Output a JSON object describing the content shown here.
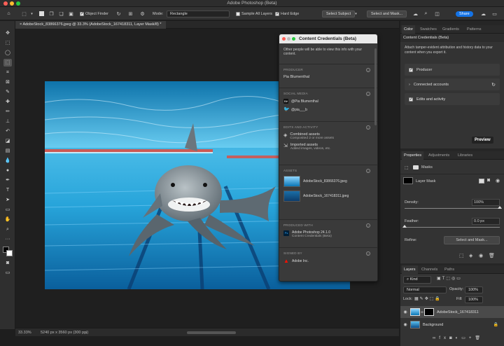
{
  "window": {
    "title": "Adobe Photoshop (Beta)",
    "traffic_colors": [
      "#ff5f57",
      "#febc2e",
      "#28c840"
    ]
  },
  "options_bar": {
    "object_finder_label": "Object Finder",
    "mode_label": "Mode:",
    "mode_value": "Rectangle",
    "sample_all_layers_label": "Sample All Layers",
    "hard_edge_label": "Hard Edge",
    "select_subject_label": "Select Subject",
    "select_and_mask_label": "Select and Mask...",
    "share_label": "Share",
    "accent_color": "#1473e6"
  },
  "document_tab": {
    "label": "AdobeStock_83866376.jpeg @ 33.3% (AdobeStock_167418311, Layer Mask/8) *"
  },
  "status_bar": {
    "zoom": "33.33%",
    "dimensions": "5240 px x 3560 px (300 ppi)"
  },
  "content_credentials": {
    "title": "Content Credentials (Beta)",
    "intro": "Other people will be able to view this info with your content.",
    "producer_header": "PRODUCER",
    "producer_name": "Pia Blumenthal",
    "social_header": "SOCIAL MEDIA",
    "social_behance": "@Pia Blumenthal",
    "social_twitter": "@pia___b",
    "edits_header": "EDITS AND ACTIVITY",
    "edit1_title": "Combined assets",
    "edit1_sub": "Composited 2 or more assets",
    "edit2_title": "Imported assets",
    "edit2_sub": "Added images, videos, etc.",
    "assets_header": "ASSETS",
    "asset1": "AdobeStock_83866376.jpeg",
    "asset2": "AdobeStock_167418311.jpeg",
    "produced_header": "PRODUCED WITH",
    "produced_app": "Adobe Photoshop 24.1.0",
    "produced_sub": "Content Credentials (Beta)",
    "signed_header": "SIGNED BY",
    "signed_by": "Adobe Inc."
  },
  "right_top": {
    "tabs": [
      "Color",
      "Swatches",
      "Gradients",
      "Patterns"
    ],
    "panel_title": "Content Credentials (Beta)",
    "description": "Attach tamper-evident attribution and history data to your content when you export it.",
    "producer_label": "Producer",
    "connected_accounts_label": "Connected accounts",
    "edits_label": "Edits and activity",
    "preview_label": "Preview"
  },
  "properties": {
    "tabs": [
      "Properties",
      "Adjustments",
      "Libraries"
    ],
    "masks_label": "Masks",
    "layer_mask_label": "Layer Mask",
    "density_label": "Density:",
    "density_value": "100%",
    "density_fraction": 1.0,
    "feather_label": "Feather:",
    "feather_value": "0.0 px",
    "feather_fraction": 0.0,
    "refine_label": "Refine:",
    "select_and_mask_label": "Select and Mask..."
  },
  "layers": {
    "tabs": [
      "Layers",
      "Channels",
      "Paths"
    ],
    "kind_label": "Kind",
    "blend_mode": "Normal",
    "opacity_label": "Opacity:",
    "opacity_value": "100%",
    "lock_label": "Lock:",
    "fill_label": "Fill:",
    "fill_value": "100%",
    "items": [
      {
        "name": "AdobeStock_167418311",
        "selected": true
      },
      {
        "name": "Background",
        "selected": false
      }
    ]
  }
}
